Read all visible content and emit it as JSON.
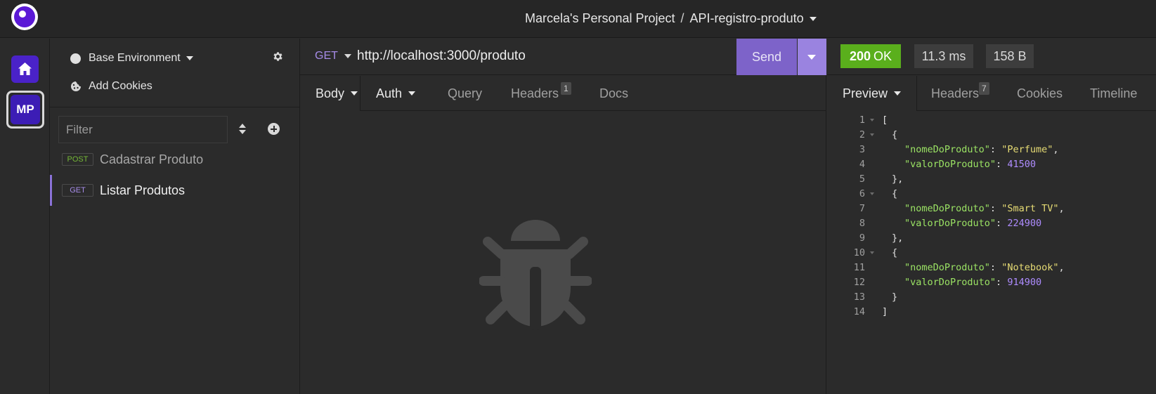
{
  "header": {
    "project": "Marcela's Personal Project",
    "separator": "/",
    "collection": "API-registro-produto"
  },
  "rail": {
    "workspace_initials": "MP"
  },
  "sidebar": {
    "environment": "Base Environment",
    "cookies": "Add Cookies",
    "filter_placeholder": "Filter",
    "requests": [
      {
        "method": "POST",
        "name": "Cadastrar Produto",
        "active": false
      },
      {
        "method": "GET",
        "name": "Listar Produtos",
        "active": true
      }
    ]
  },
  "request": {
    "method": "GET",
    "url": "http://localhost:3000/produto",
    "send_label": "Send",
    "tabs": {
      "body": "Body",
      "auth": "Auth",
      "query": "Query",
      "headers": "Headers",
      "headers_count": "1",
      "docs": "Docs"
    }
  },
  "response": {
    "status_code": "200",
    "status_text": "OK",
    "time": "11.3 ms",
    "size": "158 B",
    "status_color": "#5aaf1c",
    "tabs": {
      "preview": "Preview",
      "headers": "Headers",
      "headers_count": "7",
      "cookies": "Cookies",
      "timeline": "Timeline"
    },
    "line_numbers": [
      "1",
      "2",
      "3",
      "4",
      "5",
      "6",
      "7",
      "8",
      "9",
      "10",
      "11",
      "12",
      "13",
      "14"
    ],
    "items": [
      {
        "key_name": "\"nomeDoProduto\"",
        "name": "\"Perfume\"",
        "key_value": "\"valorDoProduto\"",
        "value": "41500"
      },
      {
        "key_name": "\"nomeDoProduto\"",
        "name": "\"Smart TV\"",
        "key_value": "\"valorDoProduto\"",
        "value": "224900"
      },
      {
        "key_name": "\"nomeDoProduto\"",
        "name": "\"Notebook\"",
        "key_value": "\"valorDoProduto\"",
        "value": "914900"
      }
    ],
    "punct": {
      "open_array": "[",
      "close_array": "]",
      "open_obj": "{",
      "close_obj_comma": "},",
      "close_obj": "}",
      "colon": ": ",
      "comma": ","
    }
  },
  "icons": {
    "logo": "insomnia-logo-icon",
    "home": "home-icon",
    "gear": "gear-icon",
    "cookie": "cookie-icon",
    "sort": "sort-icon",
    "add": "plus-circle-icon",
    "empty_state": "bug-icon"
  }
}
